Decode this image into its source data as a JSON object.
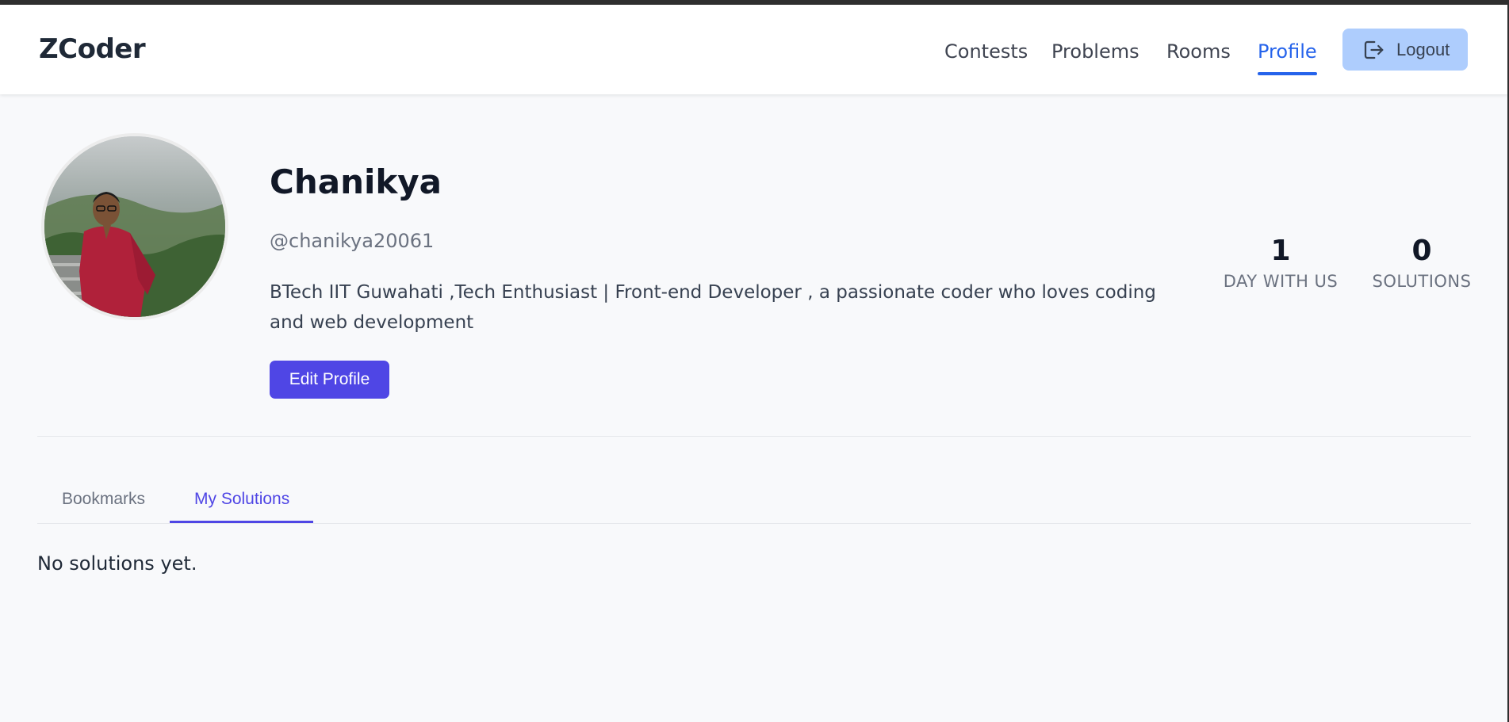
{
  "brand": "ZCoder",
  "nav": {
    "contests": "Contests",
    "problems": "Problems",
    "rooms": "Rooms",
    "profile": "Profile",
    "logout": "Logout"
  },
  "profile": {
    "name": "Chanikya",
    "handle": "@chanikya20061",
    "bio": "BTech IIT Guwahati ,Tech Enthusiast | Front-end Developer , a passionate coder who loves coding and web development",
    "edit_label": "Edit Profile"
  },
  "stats": [
    {
      "value": "1",
      "label": "DAY WITH US"
    },
    {
      "value": "0",
      "label": "SOLUTIONS"
    }
  ],
  "tabs": {
    "bookmarks": "Bookmarks",
    "my_solutions": "My Solutions",
    "active": "my_solutions"
  },
  "empty_message": "No solutions yet.",
  "colors": {
    "accent": "#2563eb",
    "primary_button": "#4f46e5",
    "logout_button": "#aecdfd"
  }
}
